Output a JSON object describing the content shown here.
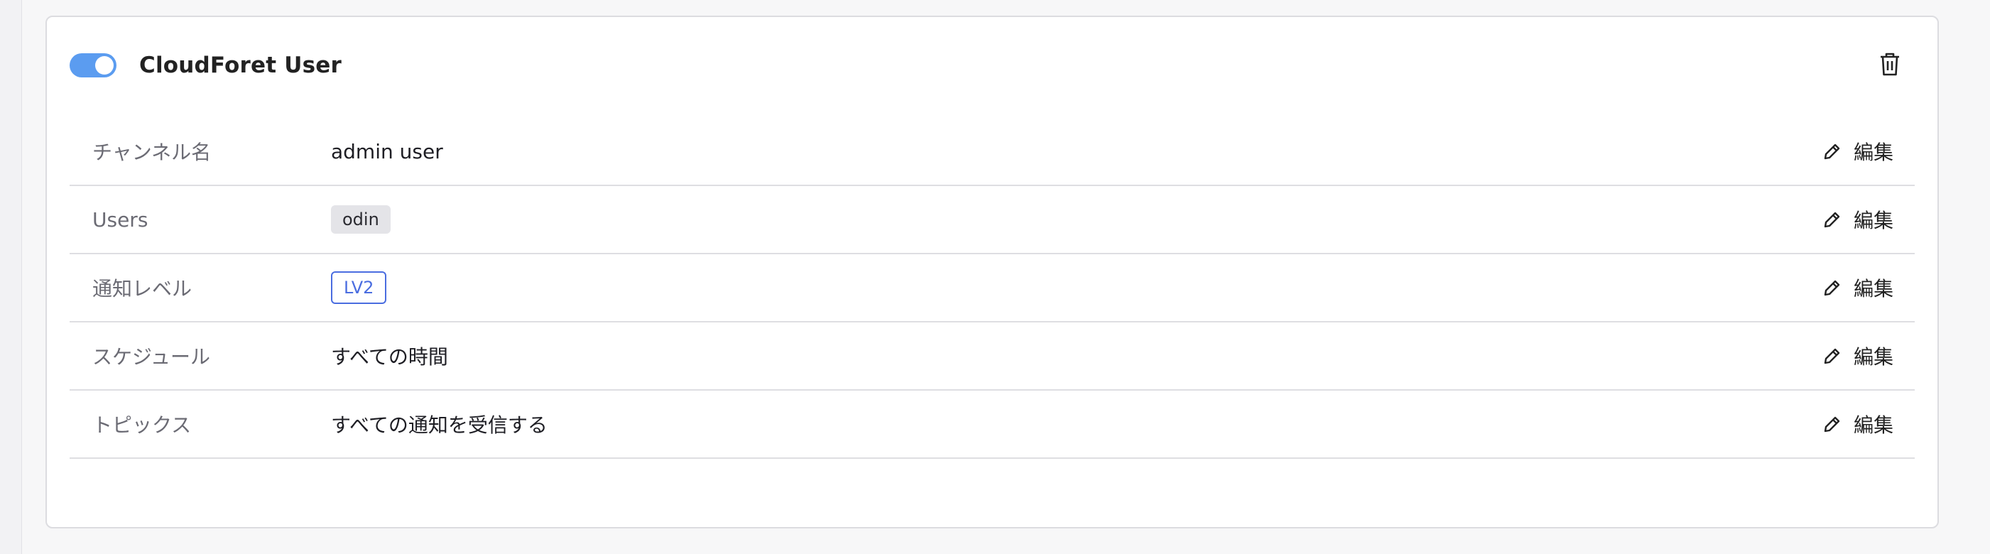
{
  "channel": {
    "title": "CloudForet User",
    "enabled": true,
    "toggle_color": "#5b9cf0",
    "delete_icon": "trash-icon"
  },
  "rows": [
    {
      "label": "チャンネル名",
      "value": "admin user",
      "edit_label": "編集"
    },
    {
      "label": "Users",
      "tag": "odin",
      "edit_label": "編集"
    },
    {
      "label": "通知レベル",
      "tag": "LV2",
      "tag_color": "#4a6de0",
      "edit_label": "編集"
    },
    {
      "label": "スケジュール",
      "value": "すべての時間",
      "edit_label": "編集"
    },
    {
      "label": "トピックス",
      "value": "すべての通知を受信する",
      "edit_label": "編集"
    }
  ],
  "edit_icon": "pencil-icon"
}
